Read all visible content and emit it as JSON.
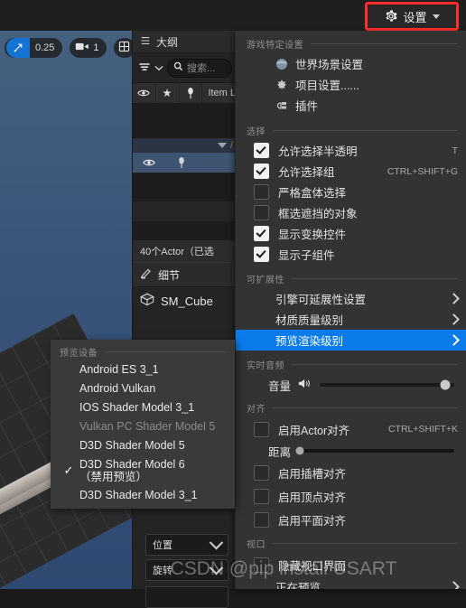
{
  "topbar": {
    "settings_button": "设置",
    "gear_icon": "gear-icon",
    "caret_icon": "chevron-down-icon",
    "highlight_color": "#ff2d2d"
  },
  "viewport": {
    "scale_value": "0.25",
    "scale_icon": "scale-arrow-icon",
    "camera_icon": "camera-icon",
    "camera_value": "1",
    "grid_icon": "grid-layout-icon"
  },
  "outliner": {
    "tab_title": "大纲",
    "tab_icon": "outliner-icon",
    "filter_icon": "filter-icon",
    "filter_caret_icon": "chevron-down-icon",
    "search_icon": "search-icon",
    "search_placeholder": "搜索...",
    "columns": {
      "eye_icon": "eye-icon",
      "star_icon": "star-icon",
      "pin_icon": "pin-icon",
      "label": "Item L"
    },
    "row_eye_icon": "eye-icon",
    "row_pin_icon": "pin-icon",
    "status": "40个Actor（已选"
  },
  "details": {
    "tab_title": "细节",
    "tab_icon": "pencil-icon",
    "object_name": "SM_Cube",
    "object_icon": "cube-icon",
    "combos": [
      {
        "label": "位置",
        "caret": "chevron-down-icon"
      },
      {
        "label": "旋转",
        "caret": "chevron-down-icon"
      }
    ]
  },
  "menu": {
    "sections": {
      "game_specific": "游戏特定设置",
      "selection": "选择",
      "scalability": "可扩展性",
      "realtime_audio": "实时音频",
      "snapping": "对齐",
      "viewport": "视口"
    },
    "game_items": [
      {
        "label": "世界场景设置",
        "icon": "globe-icon"
      },
      {
        "label": "项目设置......",
        "icon": "project-settings-icon"
      },
      {
        "label": "插件",
        "icon": "plug-icon"
      }
    ],
    "selection_items": [
      {
        "label": "允许选择半透明",
        "checked": true,
        "shortcut": "T"
      },
      {
        "label": "允许选择组",
        "checked": true,
        "shortcut": "CTRL+SHIFT+G"
      },
      {
        "label": "严格盒体选择",
        "checked": false,
        "shortcut": ""
      },
      {
        "label": "框选遮挡的对象",
        "checked": false,
        "shortcut": ""
      },
      {
        "label": "显示变换控件",
        "checked": true,
        "shortcut": ""
      },
      {
        "label": "显示子组件",
        "checked": true,
        "shortcut": ""
      }
    ],
    "scalability_items": [
      {
        "label": "引擎可延展性设置",
        "highlighted": false,
        "arrow": "chevron-right-icon"
      },
      {
        "label": "材质质量级别",
        "highlighted": false,
        "arrow": "chevron-right-icon"
      },
      {
        "label": "预览渲染级别",
        "highlighted": true,
        "arrow": "chevron-right-icon"
      }
    ],
    "audio": {
      "volume_label": "音量",
      "speaker_icon": "speaker-icon",
      "volume_percent": 93
    },
    "snapping_items": [
      {
        "label": "启用Actor对齐",
        "checked": false,
        "shortcut": "CTRL+SHIFT+K"
      },
      {
        "label": "启用插槽对齐",
        "checked": false,
        "shortcut": ""
      },
      {
        "label": "启用顶点对齐",
        "checked": false,
        "shortcut": ""
      },
      {
        "label": "启用平面对齐",
        "checked": false,
        "shortcut": ""
      }
    ],
    "distance": {
      "label": "距离",
      "percent": 2
    },
    "viewport_items": [
      {
        "label": "隐藏视口界面",
        "checked": false,
        "shortcut": ""
      }
    ],
    "preview_entry": {
      "label": "正在预览",
      "arrow": "chevron-right-icon"
    },
    "highlight_color": "#0a7bea"
  },
  "submenu": {
    "section_title": "预览设备",
    "devices": [
      {
        "label": "Android ES 3_1",
        "checked": false,
        "disabled": false
      },
      {
        "label": "Android Vulkan",
        "checked": false,
        "disabled": false
      },
      {
        "label": "IOS Shader Model 3_1",
        "checked": false,
        "disabled": false
      },
      {
        "label": "Vulkan PC Shader Model 5",
        "checked": false,
        "disabled": true
      },
      {
        "label": "D3D Shader Model 5",
        "checked": false,
        "disabled": false
      },
      {
        "label": "D3D Shader Model 6\n（禁用预览）",
        "checked": true,
        "disabled": false
      },
      {
        "label": "D3D Shader Model 3_1",
        "checked": false,
        "disabled": false
      }
    ],
    "check_glyph": "✓"
  },
  "watermark": {
    "text": "CSDN @pip install USART"
  }
}
